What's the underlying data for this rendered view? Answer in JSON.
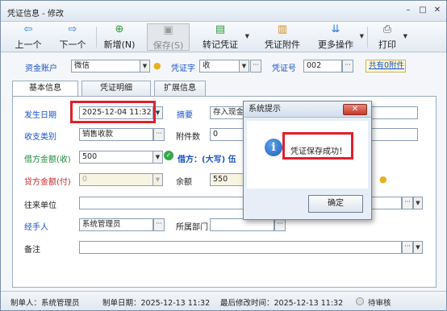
{
  "window": {
    "title": "凭证信息 - 修改",
    "min": "–",
    "max": "□",
    "close": "✕"
  },
  "toolbar": {
    "prev": "上一个",
    "next": "下一个",
    "add": "新增(N)",
    "save": "保存(S)",
    "to_voucher": "转记凭证",
    "attachment": "凭证附件",
    "more": "更多操作",
    "print": "打印"
  },
  "header": {
    "account_label": "资金账户",
    "account_value": "微信",
    "voucher_type_label": "凭证字",
    "voucher_type_value": "收",
    "voucher_no_label": "凭证号",
    "voucher_no_value": "002",
    "attachments_link": "共有0附件"
  },
  "tabs": [
    "基本信息",
    "凭证明细",
    "扩展信息"
  ],
  "form": {
    "date_label": "发生日期",
    "date_value": "2025-12-04 11:32",
    "summary_label": "摘要",
    "summary_value": "存入现金",
    "category_label": "收支类别",
    "category_value": "销售收款",
    "attach_count_label": "附件数",
    "attach_count_value": "0",
    "debit_label": "借方金额(收)",
    "debit_value": "500",
    "debit_caps_label": "借方：(大写) 伍",
    "credit_label": "贷方金额(付)",
    "credit_value": "0",
    "balance_label": "余额",
    "balance_value": "550",
    "counterparty_label": "往来单位",
    "counterparty_value": "",
    "handler_label": "经手人",
    "handler_value": "系统管理员",
    "dept_label": "所属部门",
    "dept_value": "",
    "remark_label": "备注",
    "remark_value": ""
  },
  "dialog": {
    "title": "系统提示",
    "message": "凭证保存成功！",
    "ok": "确定",
    "close": "✕"
  },
  "statusbar": {
    "creator": "制单人：系统管理员",
    "created": "制单日期：2025-12-13 11:32",
    "modified": "最后修改时间：2025-12-13 11:32",
    "review": "待审核"
  }
}
